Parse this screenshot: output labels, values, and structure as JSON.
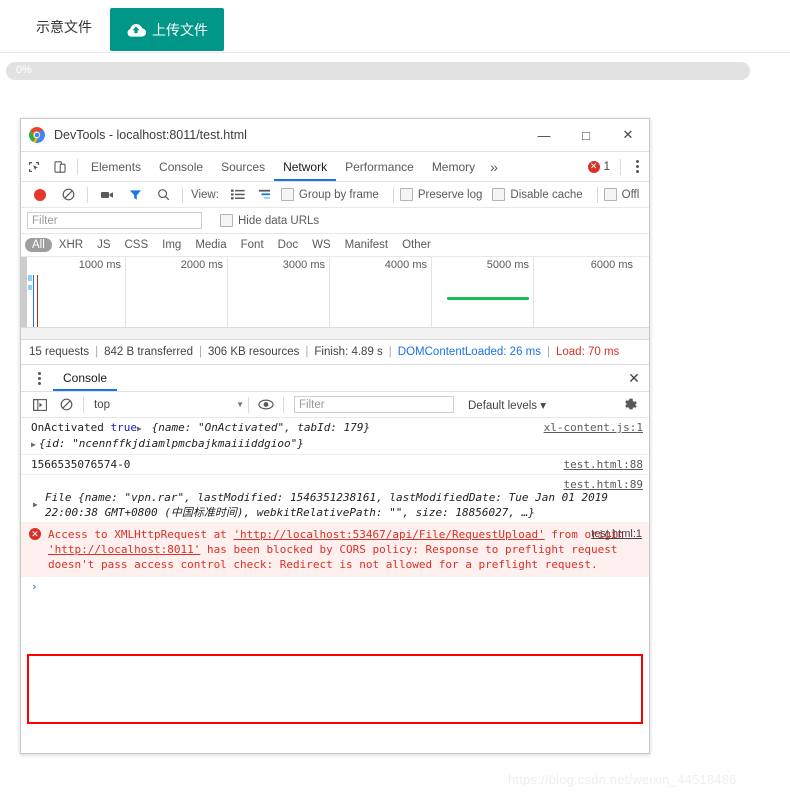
{
  "page": {
    "demo_label": "示意文件",
    "upload_button": "上传文件",
    "upload_icon": "cloud-upload-icon",
    "progress_percent": "0%",
    "watermark": "https://blog.csdn.net/weixin_44518486",
    "accent_color": "#009688"
  },
  "devtools": {
    "title": "DevTools - localhost:8011/test.html",
    "window_controls": {
      "minimize": "—",
      "maximize": "□",
      "close": "✕"
    },
    "tabs": [
      {
        "label": "Elements",
        "active": false
      },
      {
        "label": "Console",
        "active": false
      },
      {
        "label": "Sources",
        "active": false
      },
      {
        "label": "Network",
        "active": true
      },
      {
        "label": "Performance",
        "active": false
      },
      {
        "label": "Memory",
        "active": false
      }
    ],
    "more_tabs": "»",
    "error_count": "1",
    "network_toolbar": {
      "view_label": "View:",
      "checkboxes": [
        "Group by frame",
        "Preserve log",
        "Disable cache",
        "Offl"
      ],
      "filter_placeholder": "Filter",
      "hide_data_urls": "Hide data URLs"
    },
    "resource_types": [
      "All",
      "XHR",
      "JS",
      "CSS",
      "Img",
      "Media",
      "Font",
      "Doc",
      "WS",
      "Manifest",
      "Other"
    ],
    "timeline": {
      "ticks": [
        "1000 ms",
        "2000 ms",
        "3000 ms",
        "4000 ms",
        "5000 ms",
        "6000 ms"
      ]
    },
    "status": {
      "requests": "15 requests",
      "transferred": "842 B transferred",
      "resources": "306 KB resources",
      "finish": "Finish: 4.89 s",
      "dom_content_loaded": "DOMContentLoaded: 26 ms",
      "load": "Load: 70 ms",
      "dcl_color": "#1a73e8",
      "load_color": "#d93025"
    },
    "console": {
      "drawer_tab": "Console",
      "context": "top",
      "filter_placeholder": "Filter",
      "levels": "Default levels ▾",
      "prompt": "›",
      "messages": [
        {
          "id": "msg-onactivated",
          "line1_a": "OnActivated ",
          "line1_bool": "true",
          "line1_obj_pre": " {name: ",
          "line1_str": "\"OnActivated\"",
          "line1_mid": ", tabId: ",
          "line1_num": "179",
          "line1_end": "}",
          "line2_pre": "{id: ",
          "line2_str": "\"ncennffkjdiamlpmcbajkmaiiiddgioo\"",
          "line2_end": "}",
          "source": "xl-content.js:1"
        },
        {
          "id": "msg-timestamp",
          "text": "1566535076574-0",
          "source": "test.html:88"
        },
        {
          "id": "msg-file-object",
          "pre": "File {name: ",
          "name_str": "\"vpn.rar\"",
          "mid1": ", lastModified: ",
          "lastmodified": "1546351238161",
          "mid2": ", lastModifiedDate: Tue Jan 01 2019 22:00:38 GMT+0800 (",
          "tz_cn": "中国标准时间",
          "mid3": "), webkitRelativePath: ",
          "path_str": "\"\"",
          "mid4": ", size: ",
          "size": "18856027",
          "end": ", …}",
          "source": "test.html:89"
        }
      ],
      "error": {
        "part1": "Access to XMLHttpRequest at ",
        "url1": "'http://localhost:53467/api/File/RequestUpload'",
        "part2": " from origin ",
        "url2": "'http://localhost:8011'",
        "part3": " has been blocked by CORS policy: Response to preflight request doesn't pass access control check: Redirect is not allowed for a preflight request.",
        "source": "test.html:1",
        "highlight_color": "#ff0000"
      }
    }
  }
}
